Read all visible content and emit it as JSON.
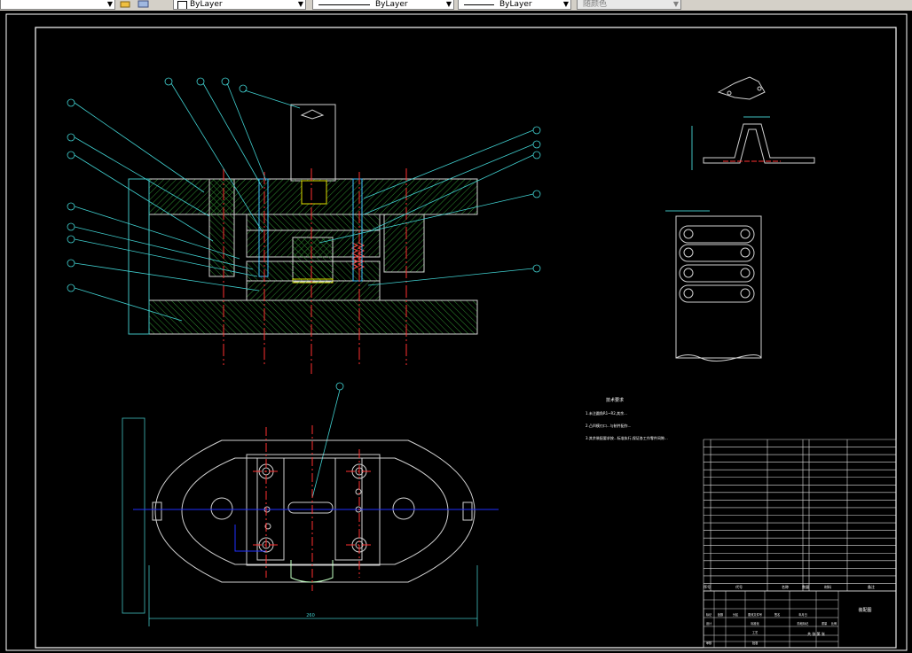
{
  "toolbar": {
    "layer_label": "ByLayer",
    "linetype_label": "ByLayer",
    "lineweight_label": "ByLayer",
    "color_label": "随颜色"
  },
  "drawing": {
    "tech_title": "技术要求",
    "tech_notes": [
      "1.未注圆角R1~R2,其余...",
      "2.凸凹模刃口...与制件配作...",
      "3.其余装配要求按...标准执行,保证各工作零件间隙..."
    ],
    "dim_width": "260",
    "bom_header": [
      "序号",
      "代号",
      "名称",
      "数量",
      "材料",
      "备注"
    ],
    "title_block": {
      "drawing_name": "装配图",
      "sheet_info": "共 张 第 张",
      "labels": [
        "标记",
        "处数",
        "分区",
        "更改文件号",
        "签名",
        "年月日",
        "设计",
        "标准化",
        "阶段标记",
        "重量",
        "比例",
        "审核",
        "工艺",
        "批准"
      ]
    }
  }
}
